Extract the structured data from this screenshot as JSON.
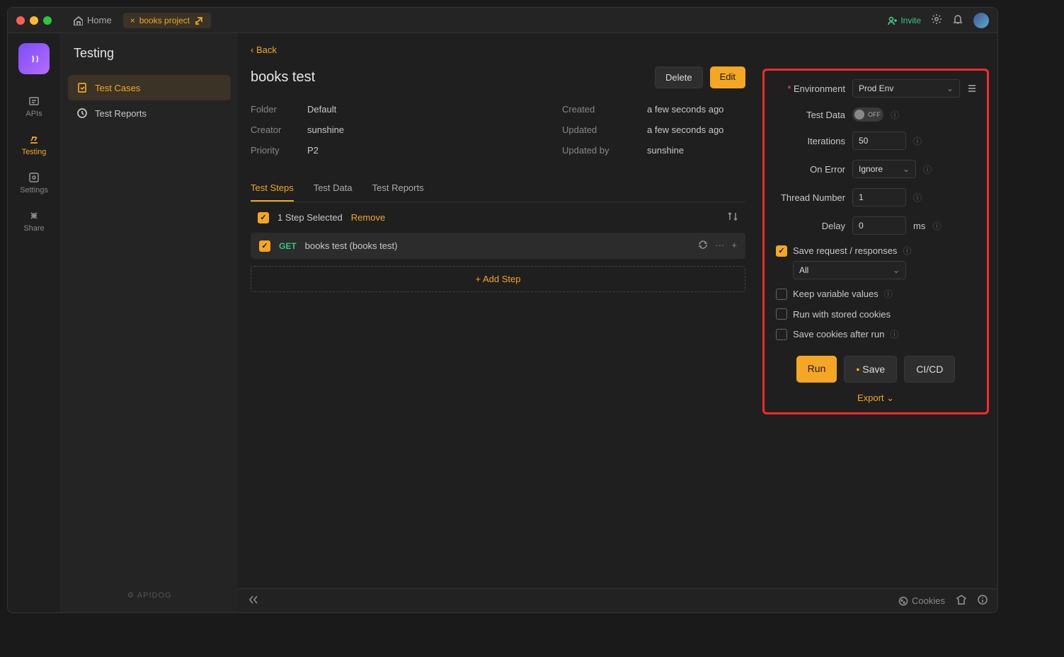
{
  "titleBar": {
    "home": "Home",
    "projectTab": "books project",
    "invite": "Invite"
  },
  "rail": {
    "items": [
      {
        "label": "APIs"
      },
      {
        "label": "Testing"
      },
      {
        "label": "Settings"
      },
      {
        "label": "Share"
      }
    ]
  },
  "sidebar": {
    "title": "Testing",
    "items": [
      {
        "label": "Test Cases"
      },
      {
        "label": "Test Reports"
      }
    ],
    "footer": "APIDOG"
  },
  "page": {
    "back": "‹ Back",
    "title": "books test",
    "deleteBtn": "Delete",
    "editBtn": "Edit",
    "meta": {
      "folderLabel": "Folder",
      "folderValue": "Default",
      "creatorLabel": "Creator",
      "creatorValue": "sunshine",
      "priorityLabel": "Priority",
      "priorityValue": "P2",
      "createdLabel": "Created",
      "createdValue": "a few seconds ago",
      "updatedLabel": "Updated",
      "updatedValue": "a few seconds ago",
      "updatedByLabel": "Updated by",
      "updatedByValue": "sunshine"
    },
    "tabs": [
      {
        "label": "Test Steps"
      },
      {
        "label": "Test Data"
      },
      {
        "label": "Test Reports"
      }
    ],
    "selectedBar": {
      "text": "1 Step Selected",
      "remove": "Remove"
    },
    "step": {
      "method": "GET",
      "name": "books test (books test)"
    },
    "addStep": "Add Step"
  },
  "runPanel": {
    "environmentLabel": "Environment",
    "environmentValue": "Prod Env",
    "testDataLabel": "Test Data",
    "testDataToggle": "OFF",
    "iterationsLabel": "Iterations",
    "iterationsValue": "50",
    "onErrorLabel": "On Error",
    "onErrorValue": "Ignore",
    "threadLabel": "Thread Number",
    "threadValue": "1",
    "delayLabel": "Delay",
    "delayValue": "0",
    "delayUnit": "ms",
    "saveReqLabel": "Save request / responses",
    "saveReqMode": "All",
    "keepVarsLabel": "Keep variable values",
    "runCookiesLabel": "Run with stored cookies",
    "saveCookiesLabel": "Save cookies after run",
    "runBtn": "Run",
    "saveBtn": "Save",
    "cicdBtn": "CI/CD",
    "exportLink": "Export"
  },
  "bottomBar": {
    "cookies": "Cookies"
  }
}
